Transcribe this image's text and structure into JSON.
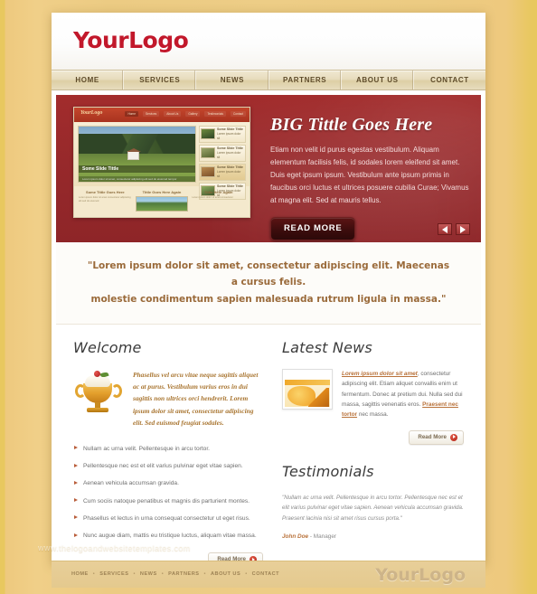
{
  "brand": {
    "logo_text": "YourLogo",
    "accent_red": "#c2182b",
    "hero_red": "#97292b",
    "tan": "#edcd86",
    "link_brown": "#b9723a"
  },
  "main_nav": [
    {
      "label": "HOME"
    },
    {
      "label": "SERVICES"
    },
    {
      "label": "NEWS"
    },
    {
      "label": "PARTNERS"
    },
    {
      "label": "ABOUT US"
    },
    {
      "label": "CONTACT"
    }
  ],
  "hero": {
    "title": "BIG Tittle Goes Here",
    "paragraph": "Etiam non velit id purus egestas vestibulum. Aliquam elementum facilisis felis, id sodales lorem eleifend sit amet. Duis eget ipsum ipsum. Vestibulum ante ipsum primis in faucibus orci luctus et ultrices posuere cubilia Curae; Vivamus at magna elit. Sed at mauris tellus.",
    "button_label": "READ MORE",
    "prev_icon": "arrow-left-icon",
    "next_icon": "arrow-right-icon",
    "screenshot": {
      "logo": "YourLogo",
      "nav": [
        "Home",
        "Services",
        "About Us",
        "Gallery",
        "Testimonials",
        "Contact"
      ],
      "slide_title": "Some Slide Tittle",
      "slide_sub": "Lorem ipsum dolor sit amet, consectetur adipiscing elit sed do eiusmod tempor",
      "thumbs": [
        {
          "label": "Some Slide Tittle",
          "sub": "Lorem ipsum dolor sit"
        },
        {
          "label": "Some Slide Tittle",
          "sub": "Lorem ipsum dolor sit"
        },
        {
          "label": "Some Slide Tittle",
          "sub": "Lorem ipsum dolor sit"
        },
        {
          "label": "Some Slide Tittle",
          "sub": "Lorem ipsum dolor sit"
        }
      ],
      "columns": [
        {
          "title": "Some Tittle Goes Here",
          "body": "Lorem ipsum dolor sit amet consectetur adipiscing elit sed do eiusmod"
        },
        {
          "title": "Tittle Goes Here Again",
          "body": ""
        },
        {
          "title": "Tittle Here Again",
          "body": "Lorem ipsum dolor sit amet consectetur"
        }
      ]
    }
  },
  "quote": {
    "line1": "\"Lorem ipsum dolor sit amet, consectetur adipiscing elit. Maecenas a cursus felis.",
    "line2": "molestie condimentum sapien malesuada rutrum ligula in massa.\""
  },
  "welcome": {
    "heading": "Welcome",
    "icon": "trophy-sundae-icon",
    "intro": "Phasellus vel arcu vitae neque sagittis aliquet ac at purus. Vestibulum varius eros in dui sagittis non ultrices orci hendrerit. Lorem ipsum dolor sit amet, consectetur adipiscing elit. Sed euismod feugiat sodales.",
    "bullets": [
      "Nullam ac urna velit. Pellentesque in arcu tortor.",
      "Pellentesque nec est et elit varius pulvinar eget vitae sapien.",
      "Aenean vehicula accumsan gravida.",
      "Cum sociis natoque penatibus et magnis dis parturient montes.",
      "Phasellus et lectus in urna consequat consectetur ut eget risus.",
      "Nunc augue diam, mattis eu tristique luctus, aliquam vitae massa."
    ],
    "read_more_label": "Read More"
  },
  "latest_news": {
    "heading": "Latest News",
    "thumb_icon": "news-website-thumbnail",
    "link1": "Lorem ipsum dolor sit amet",
    "body1": ", consectetur adipiscing elit. Etiam aliquet convallis enim ut fermentum. Donec at pretium dui. Nulla sed dui massa, sagittis venenatis eros. ",
    "link2": "Praesent nec tortor",
    "body2": " nec massa.",
    "read_more_label": "Read More"
  },
  "testimonials": {
    "heading": "Testimonials",
    "quote": "\"Nullam ac urna velit. Pellentesque in arcu tortor. Pellentesque nec est et elit varius pulvinar eget vitae sapien. Aenean vehicula accumsan gravida. Praesent lacinia nisi sit amet risus cursus porta.\"",
    "author_name": "John Doe",
    "author_role": " - Manager"
  },
  "watermark": "www.thelogoandwebsitetemplates.com",
  "footer": {
    "nav": [
      "HOME",
      "SERVICES",
      "NEWS",
      "PARTNERS",
      "ABOUT US",
      "CONTACT"
    ],
    "separator": "•",
    "logo_text": "YourLogo"
  }
}
